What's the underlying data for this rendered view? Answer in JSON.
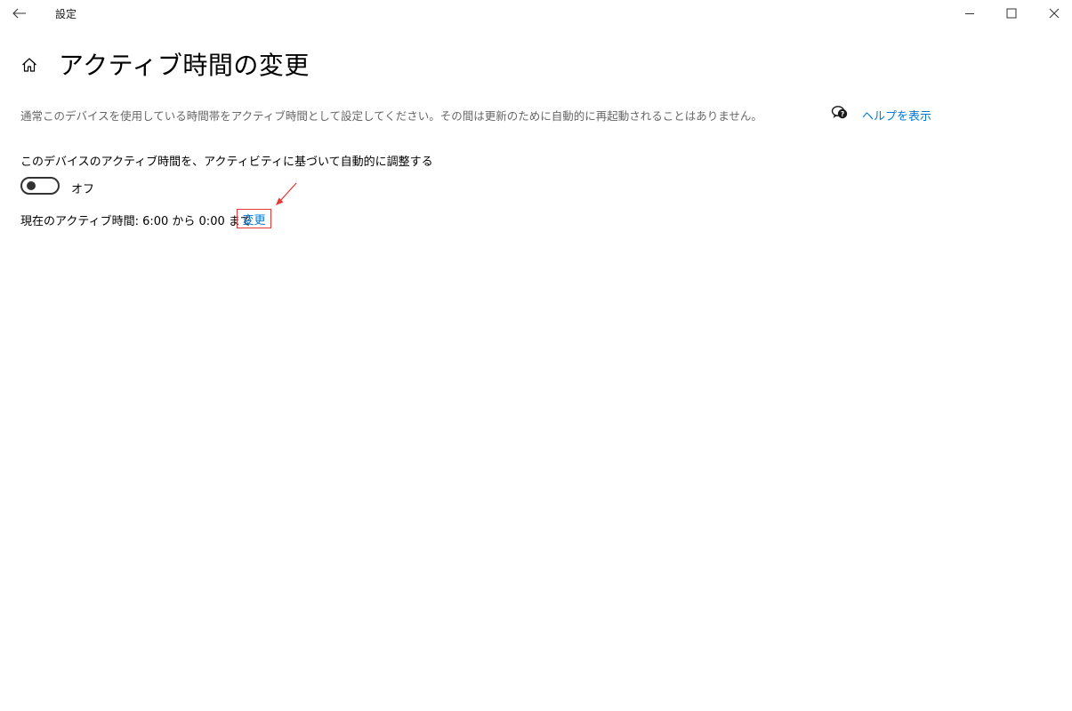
{
  "window": {
    "title": "設定",
    "controls": {
      "minimize": "minimize-icon",
      "maximize": "maximize-icon",
      "close": "close-icon"
    }
  },
  "page": {
    "title": "アクティブ時間の変更",
    "description": "通常このデバイスを使用している時間帯をアクティブ時間として設定してください。その間は更新のために自動的に再起動されることはありません。",
    "help_link": "ヘルプを表示"
  },
  "auto_adjust": {
    "label": "このデバイスのアクティブ時間を、アクティビティに基づいて自動的に調整する",
    "toggle_on": false,
    "state_label": "オフ"
  },
  "current_hours": {
    "text": "現在のアクティブ時間: 6:00 から 0:00 まで",
    "change_link": "変更"
  },
  "colors": {
    "link": "#0078d7",
    "highlight": "#e53935",
    "secondary_text": "#666666"
  }
}
